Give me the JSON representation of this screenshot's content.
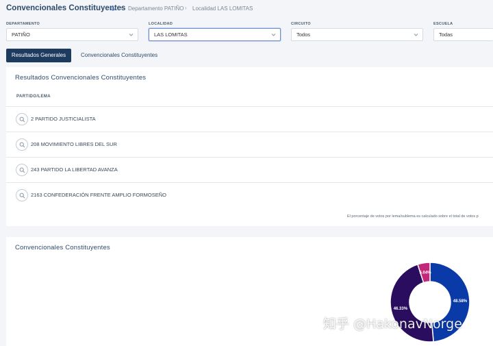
{
  "header": {
    "title": "Convencionales Constituyentes",
    "breadcrumbs": [
      "Departamento PATIÑO",
      "Localidad LAS LOMITAS"
    ]
  },
  "filters": {
    "departamento": {
      "label": "DEPARTAMENTO",
      "value": "PATIÑO"
    },
    "localidad": {
      "label": "LOCALIDAD",
      "value": "LAS LOMITAS"
    },
    "circuito": {
      "label": "CIRCUITO",
      "value": "Todos"
    },
    "escuela": {
      "label": "ESCUELA",
      "value": "Todas"
    }
  },
  "tabs": [
    {
      "label": "Resultados Generales",
      "active": true
    },
    {
      "label": "Convencionales Constituyentes",
      "active": false
    }
  ],
  "results": {
    "title": "Resultados Convencionales Constituyentes",
    "column_header": "PARTIDO/LEMA",
    "rows": [
      "2 PARTIDO JUSTICIALISTA",
      "208 MOVIMIENTO LIBRES DEL SUR",
      "243 PARTIDO LA LIBERTAD AVANZA",
      "2163 CONFEDERACIÓN FRENTE AMPLIO FORMOSEÑO"
    ],
    "footnote": "El porcentaje de votos por lema/sublema es calculado sobre el total de votos p"
  },
  "chart_section": {
    "title": "Convencionales Constituyentes"
  },
  "chart_data": {
    "type": "pie",
    "values": [
      48.58,
      46.33,
      5.04
    ],
    "labels": [
      "48.58%",
      "46.33%",
      "5.04%"
    ],
    "colors": [
      "#0a3aa8",
      "#2a0d5e",
      "#c4267a"
    ]
  },
  "watermark": "知乎 @HakonavNorge",
  "colors": {
    "primary": "#1d3b5f",
    "title": "#2e4a6b"
  }
}
